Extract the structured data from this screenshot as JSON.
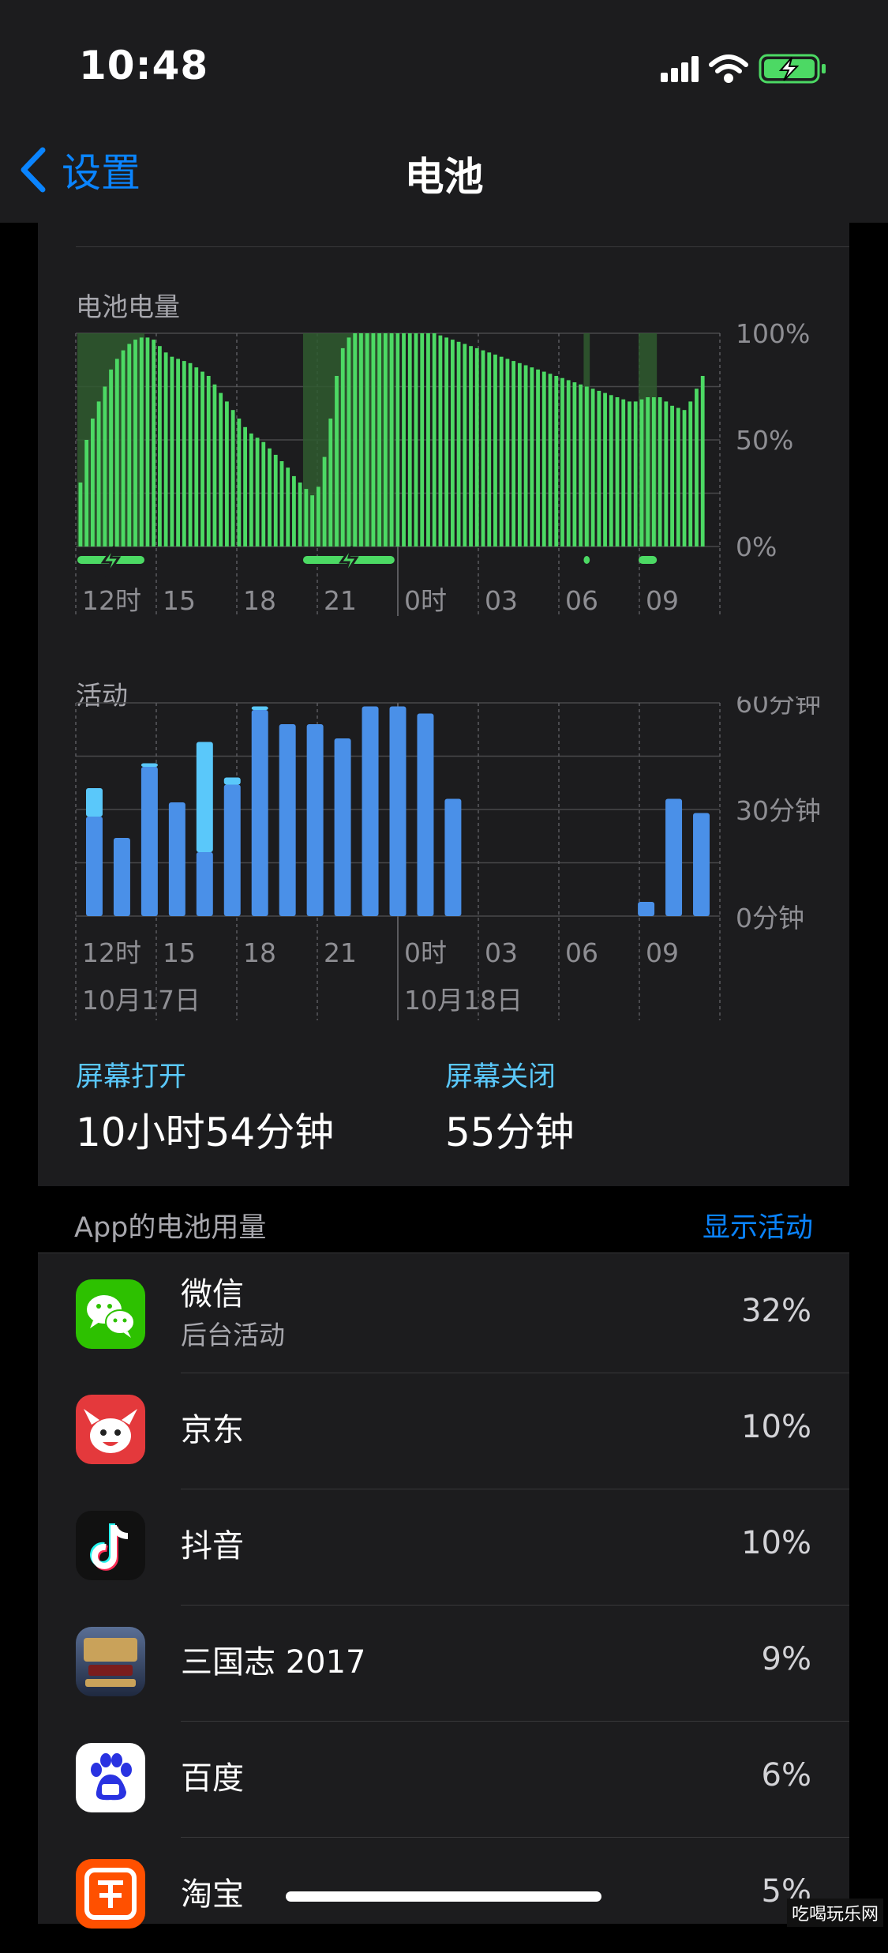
{
  "status_bar": {
    "time": "10:48"
  },
  "nav": {
    "back_label": "设置",
    "title": "电池"
  },
  "battery_chart": {
    "title": "电池电量",
    "y_ticks": [
      "100%",
      "50%",
      "0%"
    ],
    "x_ticks": [
      "12时",
      "15",
      "18",
      "21",
      "0时",
      "03",
      "06",
      "09"
    ]
  },
  "activity_chart": {
    "title": "活动",
    "y_ticks": [
      "60分钟",
      "30分钟",
      "0分钟"
    ],
    "x_ticks": [
      "12时",
      "15",
      "18",
      "21",
      "0时",
      "03",
      "06",
      "09"
    ],
    "dates": [
      "10月17日",
      "10月18日"
    ]
  },
  "screen_stats": {
    "on_label": "屏幕打开",
    "on_value": "10小时54分钟",
    "off_label": "屏幕关闭",
    "off_value": "55分钟"
  },
  "app_usage": {
    "header": "App的电池用量",
    "action": "显示活动",
    "apps": [
      {
        "name": "微信",
        "detail": "后台活动",
        "percent": "32%",
        "icon": "wechat-icon",
        "color": "#2dc100"
      },
      {
        "name": "京东",
        "detail": "",
        "percent": "10%",
        "icon": "jd-icon",
        "color": "#e4393c"
      },
      {
        "name": "抖音",
        "detail": "",
        "percent": "10%",
        "icon": "douyin-icon",
        "color": "#111111"
      },
      {
        "name": "三国志 2017",
        "detail": "",
        "percent": "9%",
        "icon": "sanguozhi-icon",
        "color": "#3b4a6b"
      },
      {
        "name": "百度",
        "detail": "",
        "percent": "6%",
        "icon": "baidu-icon",
        "color": "#2932e1"
      },
      {
        "name": "淘宝",
        "detail": "",
        "percent": "5%",
        "icon": "taobao-icon",
        "color": "#ff5000"
      }
    ]
  },
  "chart_data": [
    {
      "type": "bar",
      "title": "电池电量",
      "ylim": [
        0,
        100
      ],
      "y_unit": "%",
      "x_tick_labels": [
        "12时",
        "15",
        "18",
        "21",
        "0时",
        "03",
        "06",
        "09"
      ],
      "series": [
        {
          "values": [
            30,
            50,
            60,
            68,
            75,
            83,
            88,
            92,
            95,
            97,
            98,
            98,
            97,
            94,
            91,
            89,
            88,
            87,
            86,
            84,
            82,
            80,
            76,
            72,
            68,
            64,
            60,
            56,
            53,
            51,
            49,
            46,
            43,
            40,
            37,
            33,
            30,
            27,
            24,
            28,
            42,
            60,
            80,
            93,
            98,
            100,
            100,
            100,
            100,
            100,
            100,
            100,
            100,
            100,
            100,
            100,
            100,
            100,
            100,
            99,
            98,
            97,
            96,
            95,
            94,
            93,
            92,
            91,
            90,
            89,
            88,
            87,
            86,
            85,
            84,
            83,
            82,
            81,
            80,
            79,
            78,
            77,
            76,
            75,
            74,
            73,
            72,
            71,
            70,
            69,
            68,
            68,
            69,
            70,
            70,
            70,
            68,
            66,
            65,
            64,
            68,
            74,
            80
          ]
        }
      ],
      "charging_ranges": [
        [
          0,
          10
        ],
        [
          37,
          51
        ],
        [
          83,
          83
        ],
        [
          92,
          94
        ]
      ],
      "color": "#4cd964"
    },
    {
      "type": "bar",
      "title": "活动",
      "ylim": [
        0,
        60
      ],
      "y_unit": "分钟",
      "x_tick_labels": [
        "12时",
        "15",
        "18",
        "21",
        "0时",
        "03",
        "06",
        "09"
      ],
      "date_labels": [
        "10月17日",
        "10月18日"
      ],
      "series": [
        {
          "name": "屏幕打开",
          "values": [
            28,
            22,
            42,
            32,
            18,
            37,
            58,
            54,
            54,
            50,
            59,
            59,
            57,
            33,
            0,
            0,
            0,
            0,
            0,
            0,
            4,
            33,
            29
          ]
        },
        {
          "name": "屏幕关闭",
          "values": [
            8,
            0,
            1,
            0,
            31,
            2,
            1,
            0,
            0,
            0,
            0,
            0,
            0,
            0,
            0,
            0,
            0,
            0,
            0,
            0,
            0,
            0,
            0
          ]
        }
      ],
      "colors": [
        "#4a90e8",
        "#5ac8fa"
      ]
    }
  ]
}
